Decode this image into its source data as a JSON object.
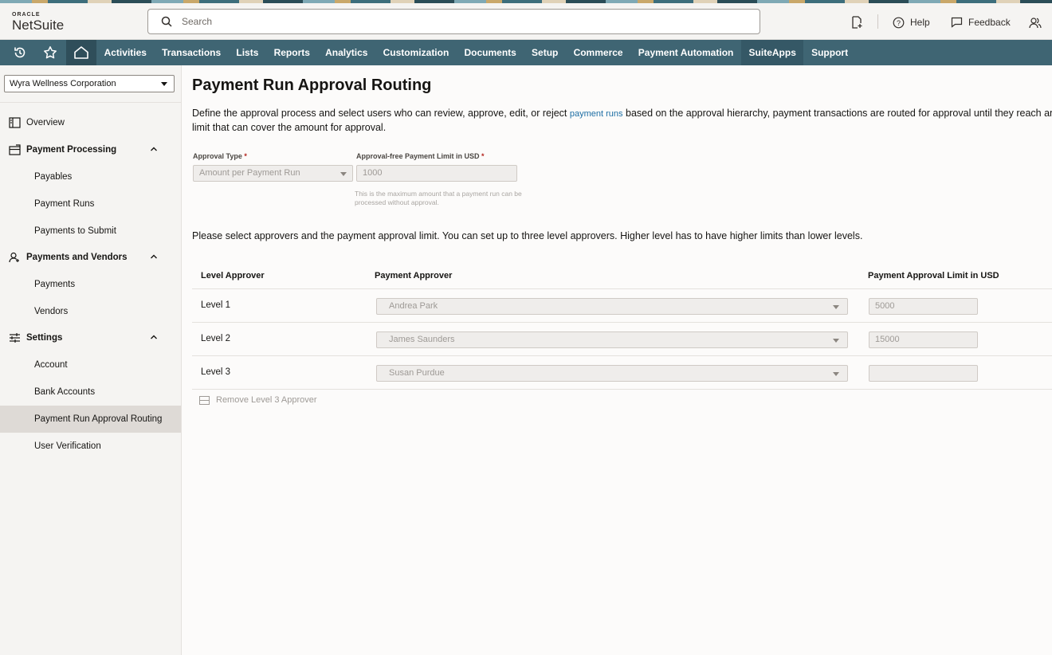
{
  "header": {
    "logo_top": "ORACLE",
    "logo_bottom": "NetSuite",
    "search_placeholder": "Search",
    "help_label": "Help",
    "feedback_label": "Feedback"
  },
  "nav": {
    "items": [
      "Activities",
      "Transactions",
      "Lists",
      "Reports",
      "Analytics",
      "Customization",
      "Documents",
      "Setup",
      "Commerce",
      "Payment Automation",
      "SuiteApps",
      "Support"
    ],
    "bg_color": "#3f6573"
  },
  "sidebar": {
    "subsidiary": "Wyra Wellness Corporation",
    "overview": "Overview",
    "sections": [
      {
        "label": "Payment Processing",
        "items": [
          "Payables",
          "Payment Runs",
          "Payments to Submit"
        ]
      },
      {
        "label": "Payments and Vendors",
        "items": [
          "Payments",
          "Vendors"
        ]
      },
      {
        "label": "Settings",
        "items": [
          "Account",
          "Bank Accounts",
          "Payment Run Approval Routing",
          "User Verification"
        ]
      }
    ],
    "selected": "Payment Run Approval Routing"
  },
  "main": {
    "title": "Payment Run Approval Routing",
    "description_before": "Define the approval process and select users who can review, approve, edit, or reject ",
    "description_link": "payment runs",
    "description_after": " based on the approval hierarchy, payment transactions are routed for approval until they reach an approver with a",
    "description_line2": "limit that can cover the amount for approval.",
    "approval_type_label": "Approval Type",
    "approval_type_value": "Amount per Payment Run",
    "free_limit_label": "Approval-free Payment Limit in USD",
    "free_limit_value": "1000",
    "free_limit_hint": "This is the maximum amount that a payment run can be processed without approval.",
    "required_mark": "*",
    "instructions": "Please select approvers and the payment approval limit. You can set up to three level approvers. Higher level has to have higher limits than lower levels.",
    "table": {
      "col_level": "Level Approver",
      "col_approver": "Payment Approver",
      "col_limit": "Payment Approval Limit in USD",
      "rows": [
        {
          "level": "Level 1",
          "approver": "Andrea Park",
          "limit": "5000"
        },
        {
          "level": "Level 2",
          "approver": "James Saunders",
          "limit": "15000"
        },
        {
          "level": "Level 3",
          "approver": "Susan Purdue",
          "limit": ""
        }
      ]
    },
    "remove_label": "Remove Level 3 Approver"
  }
}
